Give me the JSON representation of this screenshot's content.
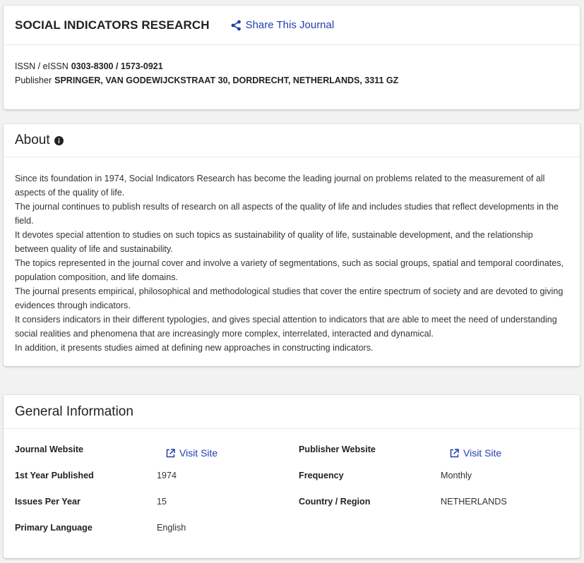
{
  "journal": {
    "title": "SOCIAL INDICATORS RESEARCH",
    "share_label": "Share This Journal",
    "issn_label": "ISSN / eISSN",
    "issn_value": "0303-8300 / 1573-0921",
    "publisher_label": "Publisher",
    "publisher_value": "SPRINGER, VAN GODEWIJCKSTRAAT 30, DORDRECHT, NETHERLANDS, 3311 GZ"
  },
  "about": {
    "title": "About",
    "paragraphs": [
      "Since its foundation in 1974, Social Indicators Research has become the leading journal on problems related to the measurement of all aspects of the quality of life.",
      "The journal continues to publish results of research on all aspects of the quality of life and includes studies that reflect developments in the field.",
      "It devotes special attention to studies on such topics as sustainability of quality of life, sustainable development, and the relationship between quality of life and sustainability.",
      "The topics represented in the journal cover and involve a variety of segmentations, such as social groups, spatial and temporal coordinates, population composition, and life domains.",
      "The journal presents empirical, philosophical and methodological studies that cover the entire spectrum of society and are devoted to giving evidences through indicators.",
      "It considers indicators in their different typologies, and gives special attention to indicators that are able to meet the need of understanding social realities and phenomena that are increasingly more complex, interrelated, interacted and dynamical.",
      "In addition, it presents studies aimed at defining new approaches in constructing indicators."
    ]
  },
  "general": {
    "title": "General Information",
    "journal_website_label": "Journal Website",
    "journal_website_link": "Visit Site",
    "publisher_website_label": "Publisher Website",
    "publisher_website_link": "Visit Site",
    "first_year_label": "1st Year Published",
    "first_year_value": "1974",
    "frequency_label": "Frequency",
    "frequency_value": "Monthly",
    "issues_label": "Issues Per Year",
    "issues_value": "15",
    "country_label": "Country / Region",
    "country_value": "NETHERLANDS",
    "language_label": "Primary Language",
    "language_value": "English"
  },
  "colors": {
    "link": "#1f3fae",
    "background": "#f2f2f2"
  }
}
